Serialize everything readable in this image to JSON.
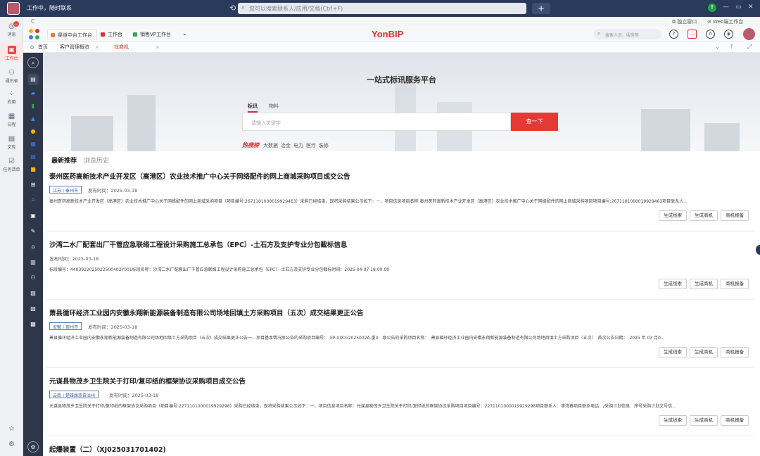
{
  "titlebar": {
    "status": "工作中，随时联系",
    "search_placeholder": "您可以搜索联系人/应用/文档(Ctrl+F)",
    "plus": "+",
    "window_controls": [
      "—",
      "▭",
      "✕"
    ]
  },
  "leftnav": [
    {
      "label": "消息",
      "icon": "message-icon",
      "glyph": "◎",
      "badge": "…"
    },
    {
      "label": "工作台",
      "icon": "workbench-icon",
      "glyph": "▣"
    },
    {
      "label": "通讯录",
      "icon": "contacts-icon",
      "glyph": "👥"
    },
    {
      "label": "应用",
      "icon": "apps-icon",
      "glyph": "⁘"
    },
    {
      "label": "日程",
      "icon": "calendar-icon",
      "glyph": "▦"
    },
    {
      "label": "文库",
      "icon": "library-icon",
      "glyph": "▤"
    },
    {
      "label": "任务清单",
      "icon": "tasks-icon",
      "glyph": "☑"
    }
  ],
  "topbar2": {
    "c": "C",
    "float_window": "独立窗口",
    "web_workbench": "Web端工作台"
  },
  "appbar": {
    "tabs": [
      "渠道中台工作台",
      "工作台",
      "销售VP工作台"
    ],
    "brand": "YonBIP",
    "search_placeholder": "搜索人员、服务等"
  },
  "pagetabs": {
    "home": "首页",
    "tabs": [
      "客户管理概览",
      "找商机"
    ]
  },
  "hero": {
    "title": "一站式标讯服务平台",
    "search_tabs": [
      "标讯",
      "物料"
    ],
    "input_placeholder": "请输入关键字",
    "search_button": "查一下",
    "hot_label": "热搜榜",
    "hot_words": [
      "大数据",
      "冶金",
      "电力",
      "医疗",
      "装修"
    ]
  },
  "list": {
    "tabs": [
      "最新推荐",
      "浏览历史"
    ],
    "buttons": [
      "生成线索",
      "生成商机",
      "商机报备"
    ],
    "items": [
      {
        "title": "泰州医药高新技术产业开发区（高港区）农业技术推广中心关于网络配件的网上商城采购项目成交公告",
        "region": "江苏丨泰州市",
        "publish": "发布时间：2025-03-18",
        "desc": "泰州医药高新技术产业开发区（高港区）农业技术推广中心关于网络配件的网上商城采购项目（项目编号:2671101000019929463）采购已经结束，现将采购结果公示如下：一、项目信息项目名称:泰州医药高新技术产业开发区（高港区）农业技术推广中心关于网络配件的网上商城采购项目项目编号:2671101000019929463项目联系人..."
      },
      {
        "title": "沙湾二水厂配套出厂干管应急联络工程设计采购施工总承包（EPC）-土石方及支护专业分包截标信息",
        "region": "",
        "publish": "发布时间：2025-03-18",
        "desc": "标段编号：4403922025022500402Y001标段名称：沙湾二水厂配套出厂干管应急联络工程设计采购施工总承包（EPC）-土石方及支护专业分包截标时间：2025-04-07 18:00:00"
      },
      {
        "title": "萧县循环经济工业园内安徽永翔新能源装备制造有限公司场地回填土方采购项目（五次）成交结果更正公告",
        "region": "安徽丨宿州市",
        "publish": "发布时间：2025-03-18",
        "desc": "萧县循环经济工业园内安徽永翔新能源装备制造有限公司场地回填土方采购项目（五次）成交结果更正公告一、项目基本情况原公告的采购项目编号：　EP-XXCG2025002A-重4　原公告的采购项目名称：　萧县循环经济工业园内安徽永翔新能源装备制造有限公司场地回填土方采购项目（五次）　首次公告日期：　2025 年 03 月0..."
      },
      {
        "title": "元谋县物茂乡卫生院关于打印/复印纸的框架协议采购项目成交公告",
        "region": "云南丨楚雄彝族自治州",
        "publish": "发布时间：2025-03-18",
        "desc": "元谋县物茂乡卫生院关于打印/复印纸的框架协议采购项目（项目编号:2271101000019929298）采购已经结束，现将采购结果公示如下：一、项目信息项目名称：元谋县物茂乡卫生院关于打印/复印纸的框架协议采购项目项目编号：2271101000019929298项目联系人：李湾春项目联系电话：/采购计划信息：序号采购计划文号信..."
      },
      {
        "title": "起爆装置（二）（XJ025031701402)",
        "region": "",
        "publish": "",
        "desc": ""
      }
    ]
  }
}
